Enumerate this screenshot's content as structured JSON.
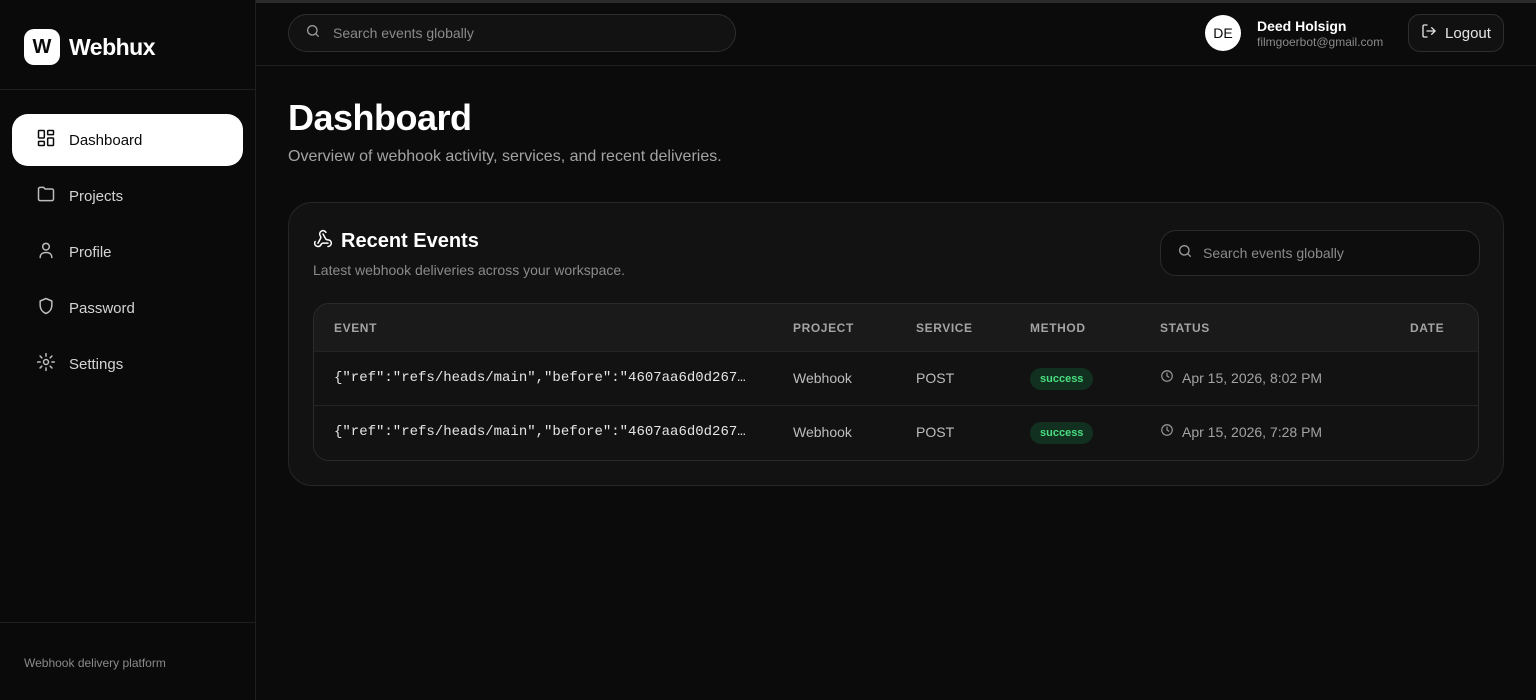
{
  "brand": {
    "logo_letter": "W",
    "name": "Webhux"
  },
  "sidebar": {
    "items": [
      {
        "label": "Dashboard",
        "icon": "grid-icon",
        "active": true
      },
      {
        "label": "Projects",
        "icon": "folder-icon"
      },
      {
        "label": "Profile",
        "icon": "user-icon"
      },
      {
        "label": "Password",
        "icon": "shield-icon"
      },
      {
        "label": "Settings",
        "icon": "gear-icon"
      }
    ],
    "footer": "Webhook delivery platform"
  },
  "topbar": {
    "search_placeholder": "Search events globally",
    "user": {
      "initials": "DE",
      "name": "Deed Holsign",
      "email": "filmgoerbot@gmail.com"
    },
    "logout_label": "Logout"
  },
  "page": {
    "title": "Dashboard",
    "subtitle": "Overview of webhook activity, services, and recent deliveries."
  },
  "recent_events": {
    "title": "Recent Events",
    "subtitle": "Latest webhook deliveries across your workspace.",
    "search_placeholder": "Search events globally",
    "columns": [
      "EVENT",
      "PROJECT",
      "SERVICE",
      "METHOD",
      "STATUS",
      "DATE"
    ],
    "rows": [
      {
        "event": "{\"ref\":\"refs/heads/main\",\"before\":\"4607aa6d0d267…",
        "project": "Webhook",
        "service": "POST",
        "method": "success",
        "status": "Apr 15, 2026, 8:02 PM"
      },
      {
        "event": "{\"ref\":\"refs/heads/main\",\"before\":\"4607aa6d0d267…",
        "project": "Webhook",
        "service": "POST",
        "method": "success",
        "status": "Apr 15, 2026, 7:28 PM"
      }
    ]
  },
  "colors": {
    "background": "#0b0b0b",
    "card": "#121212",
    "accent_active": "#ffffff",
    "success_text": "#4ade80",
    "success_bg": "#11301f"
  }
}
